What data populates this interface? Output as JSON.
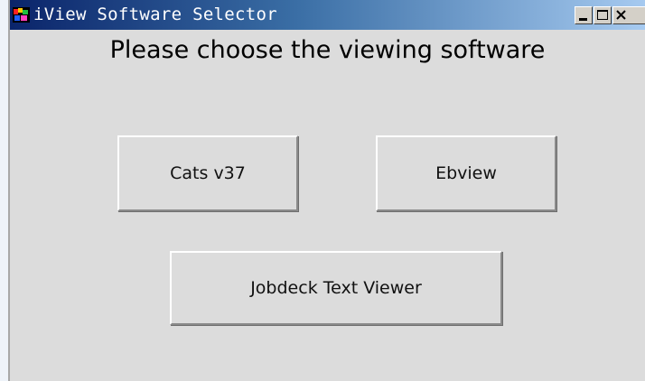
{
  "window": {
    "title": "iView Software Selector",
    "icon": "app-icon",
    "controls": {
      "minimize": "minimize-icon",
      "maximize": "maximize-icon",
      "close": "close-icon"
    }
  },
  "content": {
    "heading": "Please choose the viewing software",
    "buttons": {
      "cats": "Cats v37",
      "ebview": "Ebview",
      "jobdeck": "Jobdeck Text Viewer"
    }
  },
  "colors": {
    "titlebar_start": "#0a246a",
    "titlebar_end": "#a6caf0",
    "window_background": "#dcdcdc",
    "text": "#000000"
  }
}
